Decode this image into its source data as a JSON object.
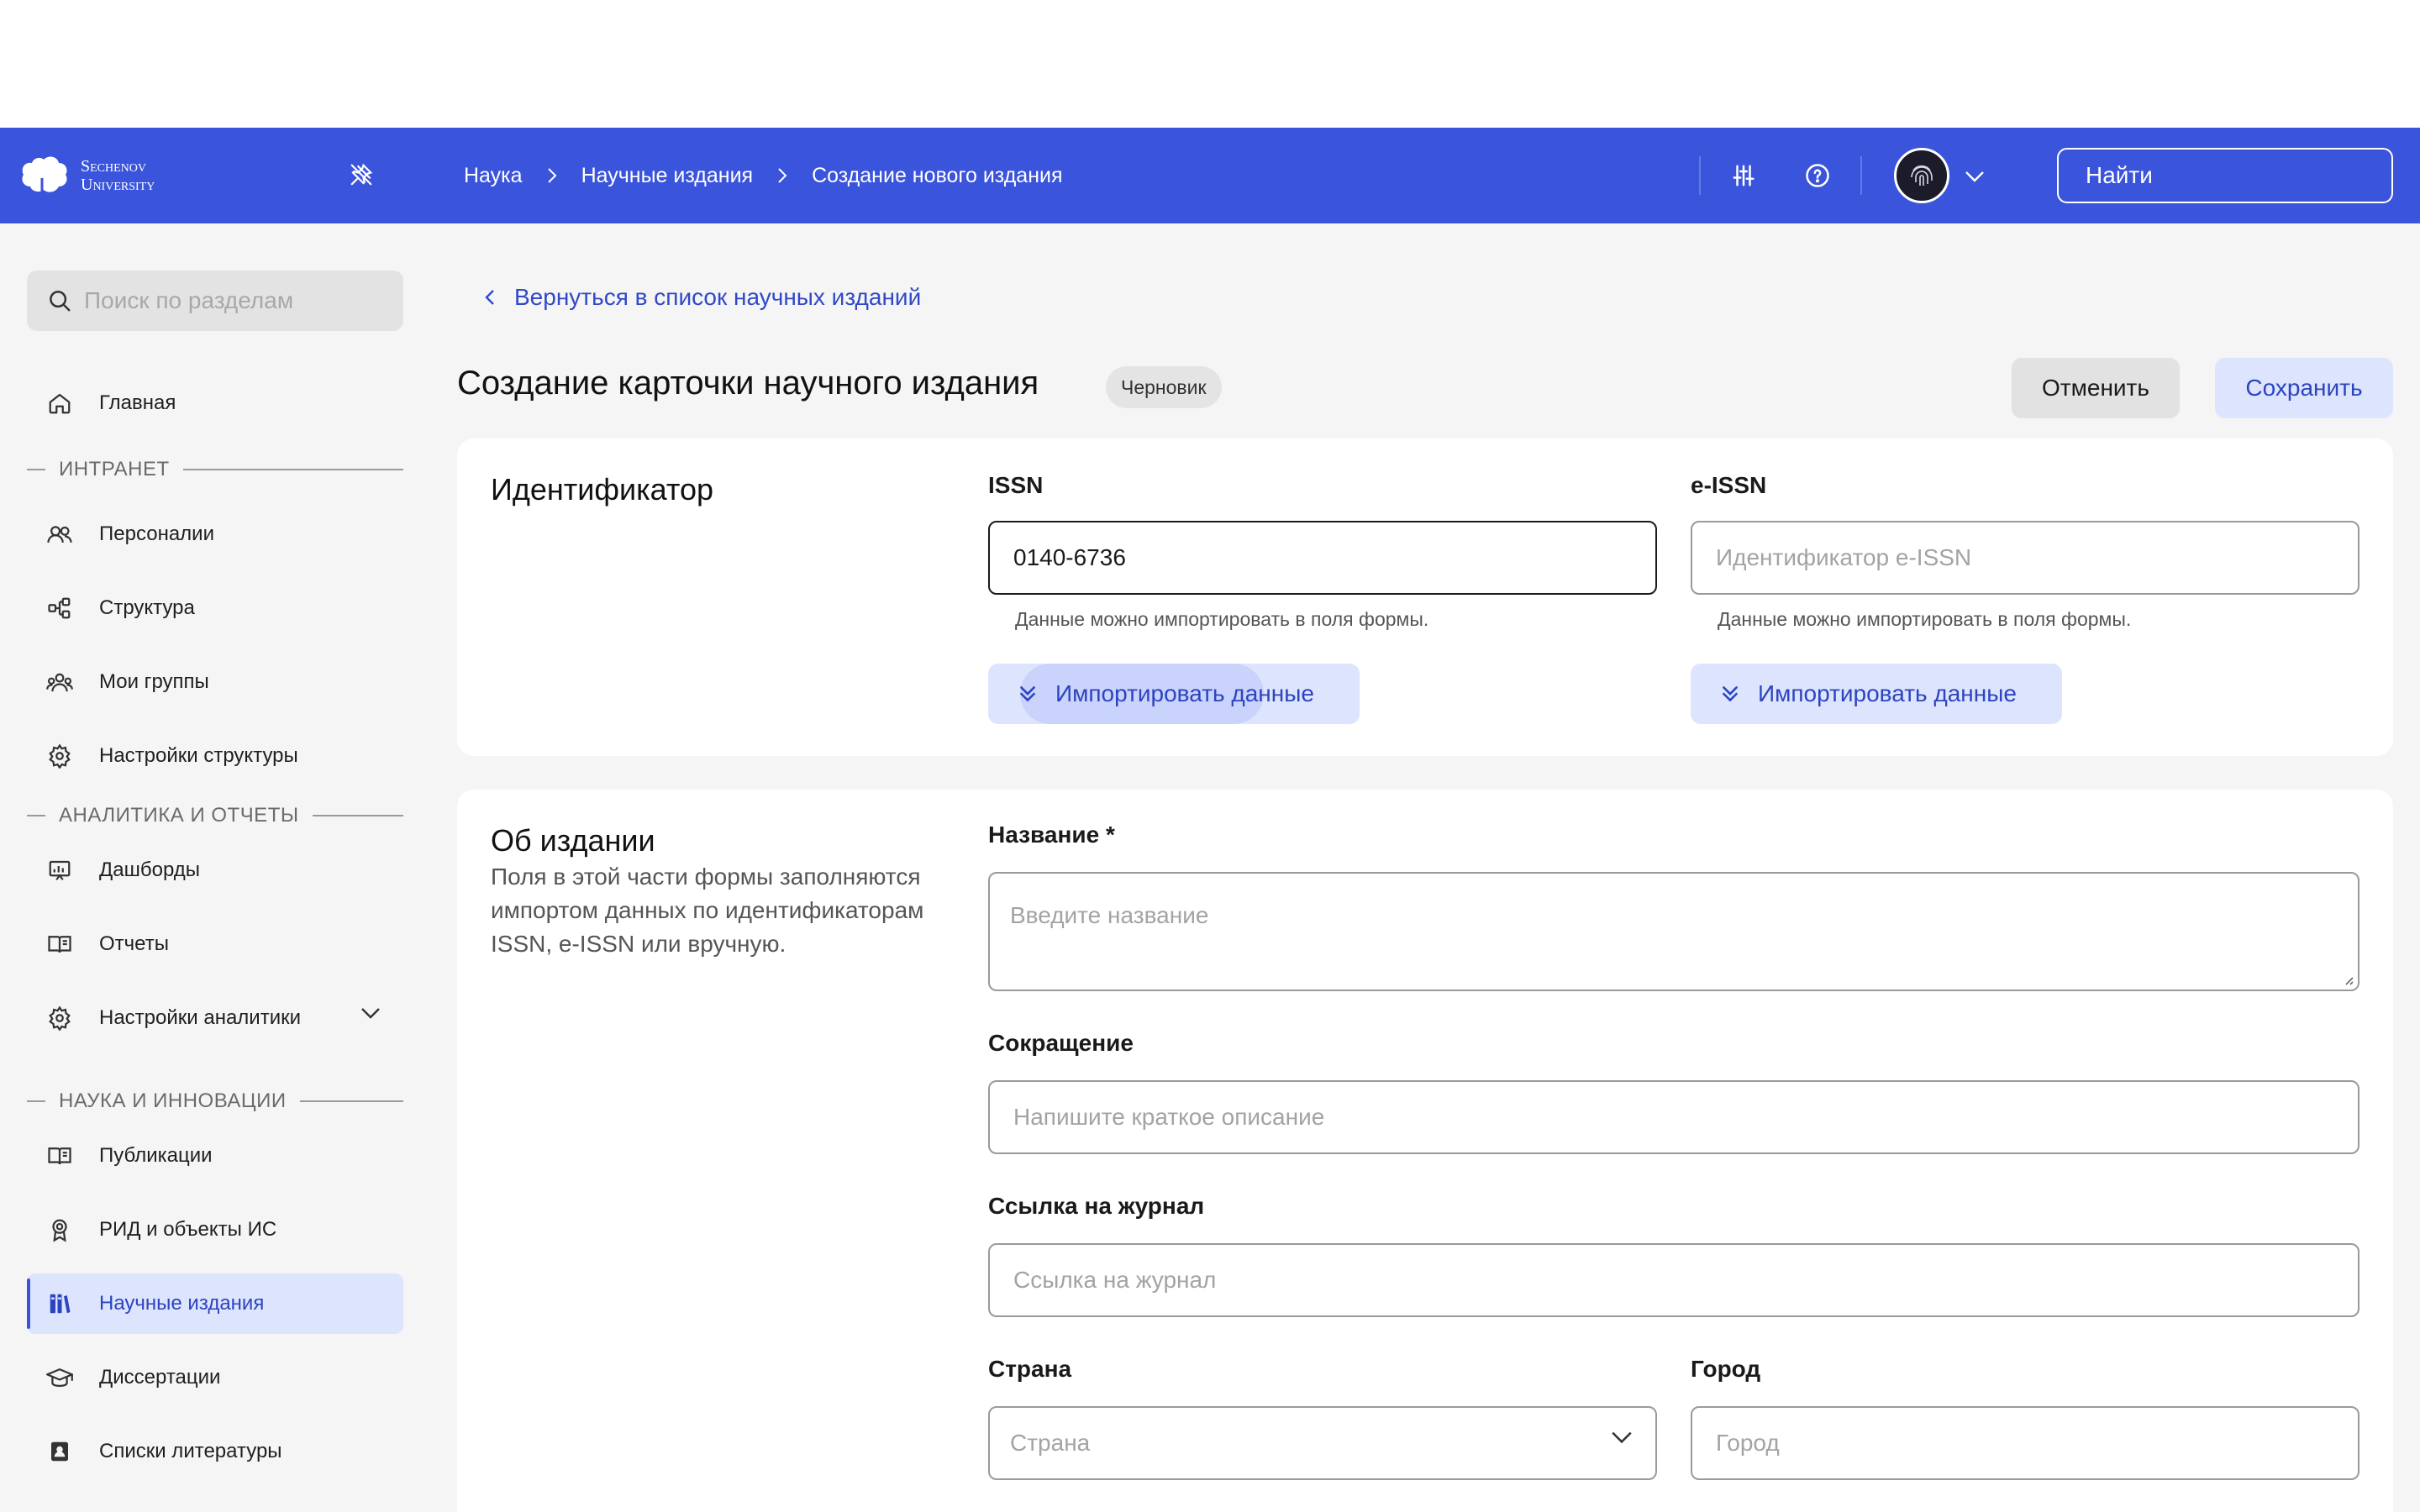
{
  "app": {
    "logo_line1": "Sechenov",
    "logo_line2": "University"
  },
  "breadcrumb": {
    "items": [
      "Наука",
      "Научные издания",
      "Создание нового издания"
    ]
  },
  "header": {
    "search_placeholder": "Найти",
    "icons": [
      "pin-off-icon",
      "sliders-icon",
      "help-icon",
      "avatar",
      "chevron-down-icon",
      "search-icon"
    ]
  },
  "sidebar": {
    "search_placeholder": "Поиск по разделам",
    "home_label": "Главная",
    "sections": {
      "intranet": "ИНТРАНЕТ",
      "analytics": "АНАЛИТИКА И ОТЧЕТЫ",
      "science": "НАУКА И ИННОВАЦИИ"
    },
    "items": {
      "persons": "Персоналии",
      "structure": "Структура",
      "groups": "Мои группы",
      "structure_settings": "Настройки структуры",
      "dashboards": "Дашборды",
      "reports": "Отчеты",
      "analytics_settings": "Настройки аналитики",
      "publications": "Публикации",
      "rid": "РИД и объекты ИС",
      "journals": "Научные издания",
      "dissertations": "Диссертации",
      "literature": "Списки литературы"
    },
    "active": "journals"
  },
  "page": {
    "back_link": "Вернуться в список научных изданий",
    "title": "Создание карточки научного издания",
    "badge": "Черновик",
    "cancel_label": "Отменить",
    "save_label": "Сохранить"
  },
  "identifier": {
    "title": "Идентификатор",
    "issn_label": "ISSN",
    "issn_value": "0140-6736",
    "eissn_label": "e-ISSN",
    "eissn_placeholder": "Идентификатор e-ISSN",
    "helper": "Данные можно импортировать в поля формы.",
    "import_label": "Импортировать данные"
  },
  "about": {
    "title": "Об издании",
    "description": "Поля в этой части формы заполняются импортом данных по идентификаторам ISSN, e-ISSN или вручную.",
    "name_label": "Название",
    "required_mark": "*",
    "name_placeholder": "Введите название",
    "short_label": "Сокращение",
    "short_placeholder": "Напишите краткое описание",
    "link_label": "Ссылка на журнал",
    "link_placeholder": "Ссылка на журнал",
    "country_label": "Страна",
    "country_placeholder": "Страна",
    "city_label": "Город",
    "city_placeholder": "Город"
  },
  "colors": {
    "brand": "#3a54db",
    "accent_bg": "#dde4fd",
    "accent_text": "#2c44c0"
  }
}
